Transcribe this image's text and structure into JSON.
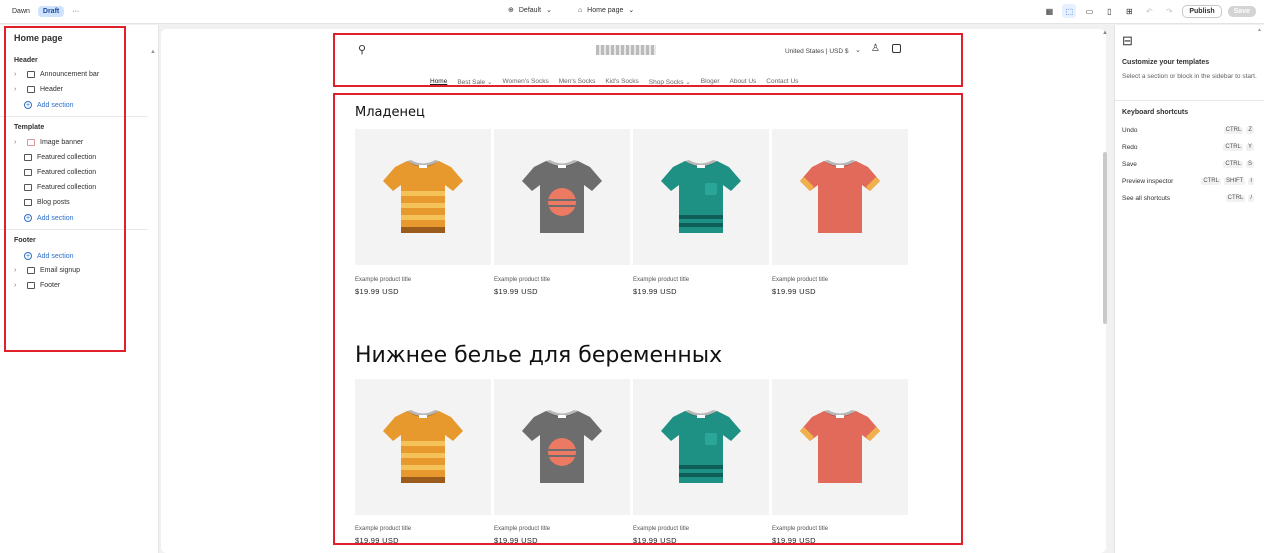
{
  "topbar": {
    "theme_name": "Dawn",
    "status_badge": "Draft",
    "more": "···",
    "default_label": "Default",
    "page_label": "Home page",
    "publish_label": "Publish",
    "save_label": "Save"
  },
  "sidebar": {
    "title": "Home page",
    "header_group": "Header",
    "header_items": [
      "Announcement bar",
      "Header"
    ],
    "add_section": "Add section",
    "template_group": "Template",
    "template_items": [
      "Image banner",
      "Featured collection",
      "Featured collection",
      "Featured collection",
      "Blog posts"
    ],
    "footer_group": "Footer",
    "footer_items": [
      "Email signup",
      "Footer"
    ]
  },
  "store": {
    "currency": "United States | USD $",
    "nav": [
      "Home",
      "Best Sale",
      "Women's Socks",
      "Men's Socks",
      "Kid's Socks",
      "Shop Socks",
      "Bloger",
      "About Us",
      "Contact Us"
    ],
    "collections": [
      {
        "title": "Младенец"
      },
      {
        "title": "Нижнее белье для беременных"
      }
    ],
    "product_title": "Example product title",
    "product_price": "$19.99 USD",
    "product_colors": [
      "#e7992e",
      "#6d6d6d",
      "#1f9184",
      "#e16a5a"
    ]
  },
  "right_panel": {
    "heading": "Customize your templates",
    "description": "Select a section or block in the sidebar to start.",
    "shortcuts_heading": "Keyboard shortcuts",
    "shortcuts": [
      {
        "label": "Undo",
        "keys": [
          "CTRL",
          "Z"
        ]
      },
      {
        "label": "Redo",
        "keys": [
          "CTRL",
          "Y"
        ]
      },
      {
        "label": "Save",
        "keys": [
          "CTRL",
          "S"
        ]
      },
      {
        "label": "Preview inspector",
        "keys": [
          "CTRL",
          "SHIFT",
          "I"
        ]
      },
      {
        "label": "See all shortcuts",
        "keys": [
          "CTRL",
          "/"
        ]
      }
    ]
  }
}
